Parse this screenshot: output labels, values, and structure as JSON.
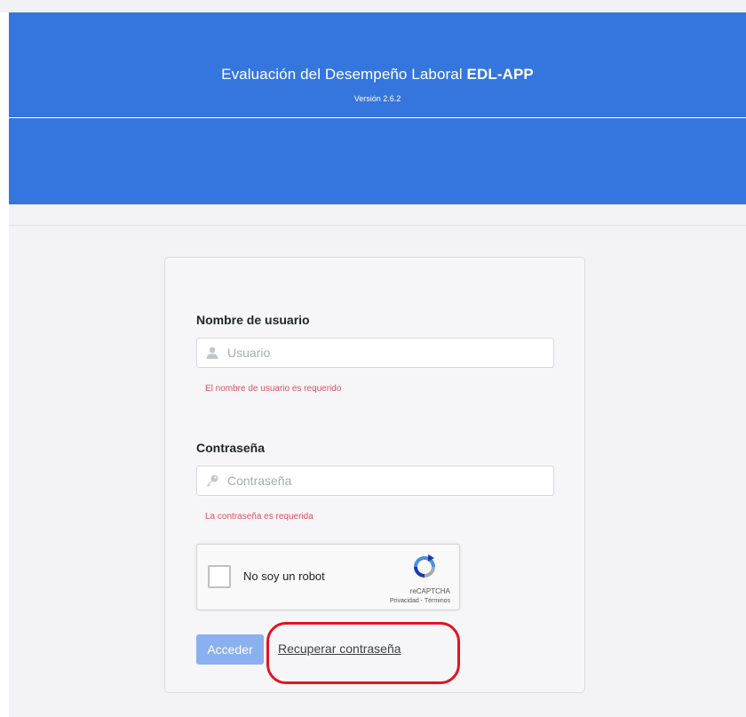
{
  "header": {
    "title_prefix": "Evaluación del Desempeño Laboral ",
    "title_app": "EDL-APP",
    "version": "Versión 2.6.2"
  },
  "login": {
    "username_label": "Nombre de usuario",
    "username_placeholder": "Usuario",
    "username_value": "",
    "username_error": "El nombre de usuario es requerido",
    "username_icon": "user-icon",
    "password_label": "Contraseña",
    "password_placeholder": "Contraseña",
    "password_value": "",
    "password_error": "La contraseña es requerida",
    "password_icon": "key-icon",
    "submit_label": "Acceder",
    "recover_label": "Recuperar contraseña"
  },
  "recaptcha": {
    "label": "No soy un robot",
    "brand": "reCAPTCHA",
    "links": "Privacidad - Términos",
    "icon": "recaptcha-logo-icon",
    "checked": false
  },
  "colors": {
    "header_bg": "#3476de",
    "error": "#e34d5f",
    "button_disabled": "#8bb0ef",
    "annotation": "#e3141f"
  }
}
